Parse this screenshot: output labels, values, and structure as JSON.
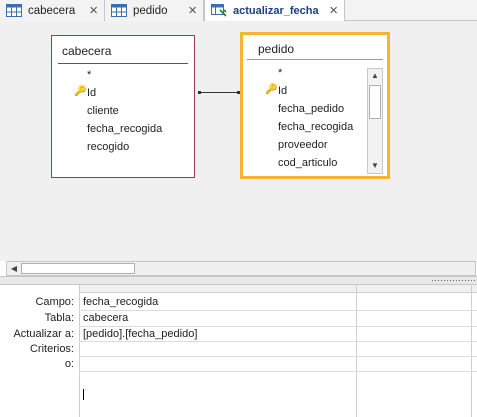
{
  "tabs": [
    {
      "label": "cabecera",
      "icon": "table-icon"
    },
    {
      "label": "pedido",
      "icon": "table-icon"
    },
    {
      "label": "actualizar_fecha",
      "icon": "update-query-icon"
    }
  ],
  "tab_close_glyph": "×",
  "tables": {
    "cabecera": {
      "title": "cabecera",
      "fields": [
        "*",
        "Id",
        "cliente",
        "fecha_recogida",
        "recogido"
      ],
      "key_field_index": 1
    },
    "pedido": {
      "title": "pedido",
      "fields": [
        "*",
        "Id",
        "fecha_pedido",
        "fecha_recogida",
        "proveedor",
        "cod_articulo"
      ],
      "key_field_index": 1
    }
  },
  "grid": {
    "row_labels": {
      "campo": "Campo:",
      "tabla": "Tabla:",
      "actualizar": "Actualizar a:",
      "criterios": "Criterios:",
      "o": "o:"
    },
    "column1": {
      "campo": "fecha_recogida",
      "tabla": "cabecera",
      "actualizar": "[pedido].[fecha_pedido]",
      "criterios": "",
      "o": ""
    }
  },
  "colors": {
    "active_table_border": "#f2b630",
    "table_border": "#9f3a4a",
    "active_tab_text": "#1a3e8a"
  }
}
